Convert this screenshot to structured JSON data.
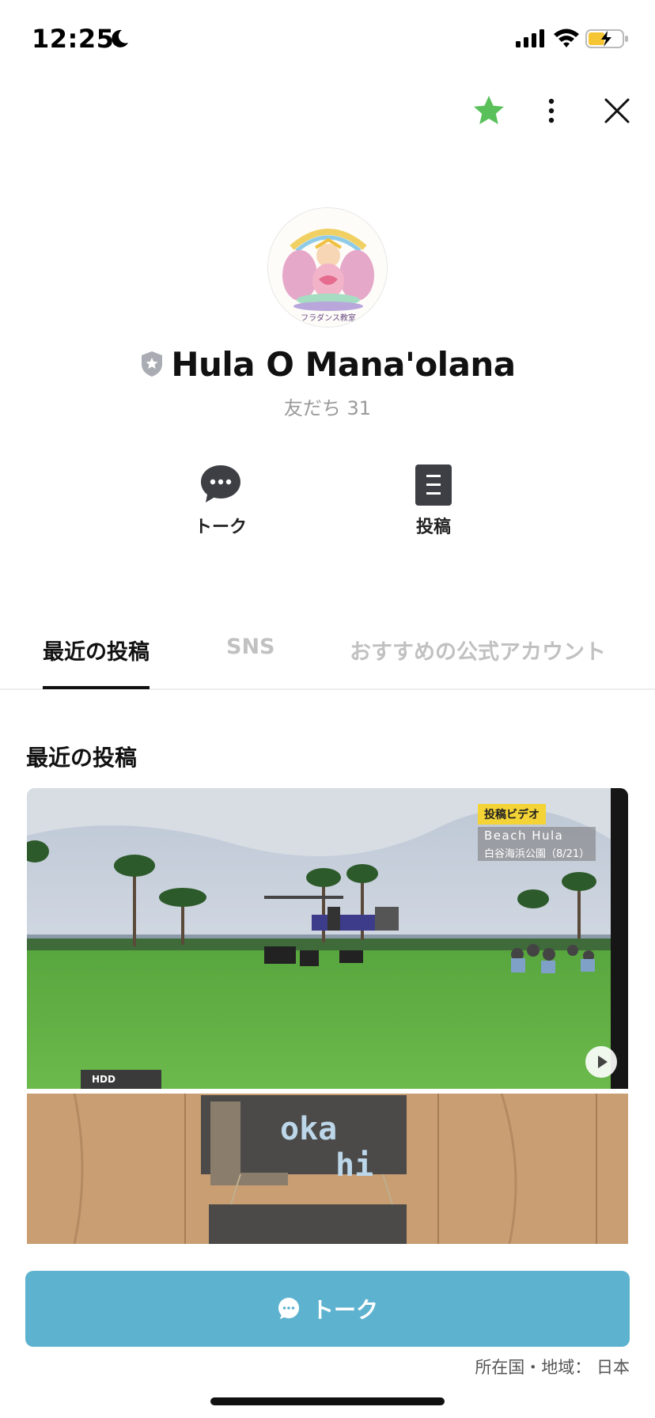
{
  "status_bar": {
    "time": "12:25"
  },
  "profile": {
    "name": "Hula O Mana'olana",
    "friends_label": "友だち 31",
    "avatar_caption": "フラダンス教室"
  },
  "actions": {
    "talk_label": "トーク",
    "post_label": "投稿"
  },
  "tabs": [
    {
      "label": "最近の投稿",
      "active": true
    },
    {
      "label": "SNS",
      "active": false
    },
    {
      "label": "おすすめの公式アカウント",
      "active": false
    }
  ],
  "section": {
    "title": "最近の投稿"
  },
  "posts": [
    {
      "type": "video",
      "tag": "投稿ビデオ",
      "line1": "Beach Hula",
      "line2": "白谷海浜公園（8/21）",
      "hdd_label": "HDD"
    },
    {
      "type": "image",
      "sign_text_1": "oka",
      "sign_text_2": "hi"
    }
  ],
  "cta": {
    "label": "トーク"
  },
  "footer": {
    "region": "所在国・地域： 日本"
  },
  "colors": {
    "accent_green": "#5ac05a",
    "cta_blue": "#5db3cf"
  },
  "icons": [
    "moon-icon",
    "signal-icon",
    "wifi-icon",
    "battery-icon",
    "star-icon",
    "more-icon",
    "close-icon",
    "shield-icon",
    "chat-icon",
    "post-icon",
    "play-icon"
  ]
}
